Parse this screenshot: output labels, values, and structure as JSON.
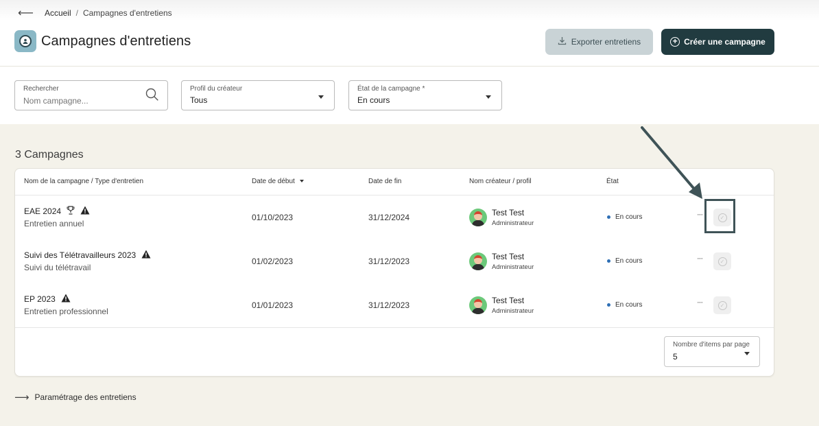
{
  "breadcrumb": {
    "home": "Accueil",
    "separator": "/",
    "current": "Campagnes d'entretiens"
  },
  "header": {
    "title": "Campagnes d'entretiens",
    "export_label": "Exporter entretiens",
    "create_label": "Créer une campagne"
  },
  "filters": {
    "search": {
      "label": "Rechercher",
      "placeholder": "Nom campagne..."
    },
    "creator_profile": {
      "label": "Profil du créateur",
      "value": "Tous"
    },
    "campaign_state": {
      "label": "État de la campagne *",
      "value": "En cours"
    }
  },
  "list": {
    "count_label": "3 Campagnes",
    "columns": {
      "name": "Nom de la campagne / Type d'entretien",
      "start": "Date de début",
      "end": "Date de fin",
      "creator": "Nom créateur / profil",
      "state": "État"
    },
    "rows": [
      {
        "name": "EAE 2024",
        "type": "Entretien annuel",
        "start": "01/10/2023",
        "end": "31/12/2024",
        "creator": "Test Test",
        "profile": "Administrateur",
        "state": "En cours",
        "more": "···"
      },
      {
        "name": "Suivi des Télétravailleurs 2023",
        "type": "Suivi du télétravail",
        "start": "01/02/2023",
        "end": "31/12/2023",
        "creator": "Test Test",
        "profile": "Administrateur",
        "state": "En cours",
        "more": "···"
      },
      {
        "name": "EP 2023",
        "type": "Entretien professionnel",
        "start": "01/01/2023",
        "end": "31/12/2023",
        "creator": "Test Test",
        "profile": "Administrateur",
        "state": "En cours",
        "more": "···"
      }
    ],
    "per_page": {
      "label": "Nombre d'items par page",
      "value": "5"
    }
  },
  "footer": {
    "settings_link": "Paramétrage des entretiens"
  },
  "colors": {
    "primary": "#213b40",
    "status_dot": "#2f6fb5",
    "background": "#f4f2ea"
  }
}
